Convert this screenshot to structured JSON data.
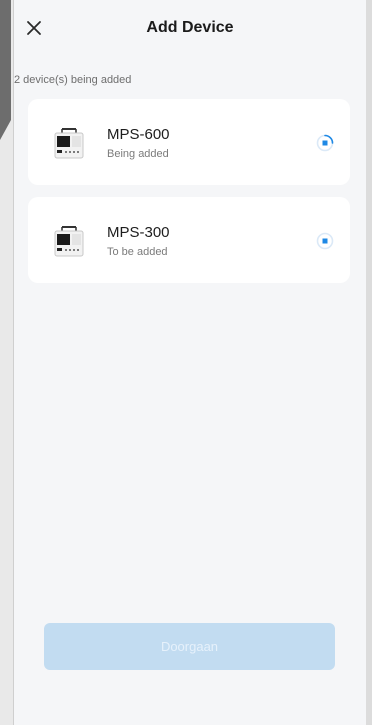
{
  "header": {
    "title": "Add Device",
    "close_icon": "close-icon"
  },
  "summary": {
    "text": "2 device(s) being added"
  },
  "devices": [
    {
      "name": "MPS-600",
      "status": "Being added",
      "icon": "power-station-icon",
      "indicator": "loading-spinner"
    },
    {
      "name": "MPS-300",
      "status": "To be added",
      "icon": "power-station-icon",
      "indicator": "pending-stop"
    }
  ],
  "footer": {
    "button_label": "Doorgaan",
    "button_color": "#c2dcf1"
  },
  "colors": {
    "accent": "#1e88e5",
    "background": "#f5f6f8",
    "card": "#ffffff"
  }
}
